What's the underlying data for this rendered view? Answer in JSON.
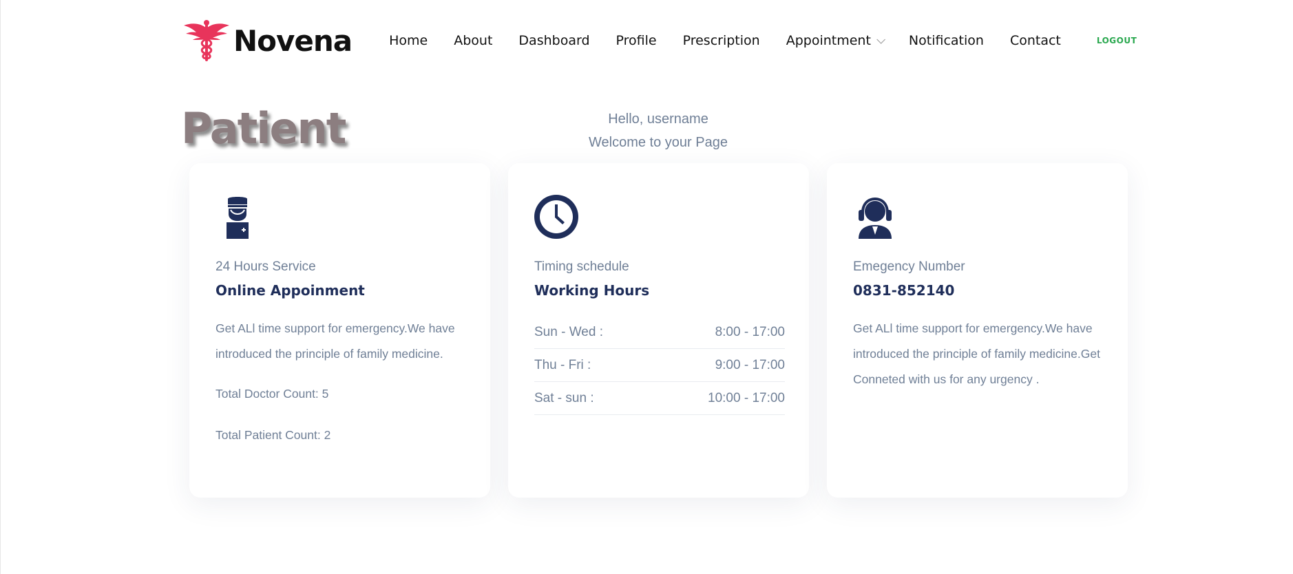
{
  "brand": {
    "name": "Novena",
    "logo_color": "#e8345b"
  },
  "nav": {
    "items": [
      "Home",
      "About",
      "Dashboard",
      "Profile",
      "Prescription",
      "Appointment",
      "Notification",
      "Contact"
    ],
    "logout": "LOGOUT"
  },
  "header": {
    "title": "Patient",
    "greeting": "Hello, username",
    "welcome": "Welcome to your Page"
  },
  "cards": [
    {
      "icon": "doctor-icon",
      "subtitle": "24 Hours Service",
      "heading": "Online Appoinment",
      "text": "Get ALl time support for emergency.We have introduced the principle of family medicine.",
      "stats": [
        "Total Doctor Count: 5",
        "Total Patient Count: 2"
      ]
    },
    {
      "icon": "clock-icon",
      "subtitle": "Timing schedule",
      "heading": "Working Hours",
      "hours": [
        {
          "day": "Sun - Wed :",
          "time": "8:00 - 17:00"
        },
        {
          "day": "Thu - Fri :",
          "time": "9:00 - 17:00"
        },
        {
          "day": "Sat - sun :",
          "time": "10:00 - 17:00"
        }
      ]
    },
    {
      "icon": "headset-icon",
      "subtitle": "Emegency Number",
      "heading": "0831-852140",
      "text": "Get ALl time support for emergency.We have introduced the principle of family medicine.Get Conneted with us for any urgency ."
    }
  ],
  "colors": {
    "primary": "#1f2e5a",
    "muted": "#6f7f96",
    "logout": "#2aa84f"
  }
}
